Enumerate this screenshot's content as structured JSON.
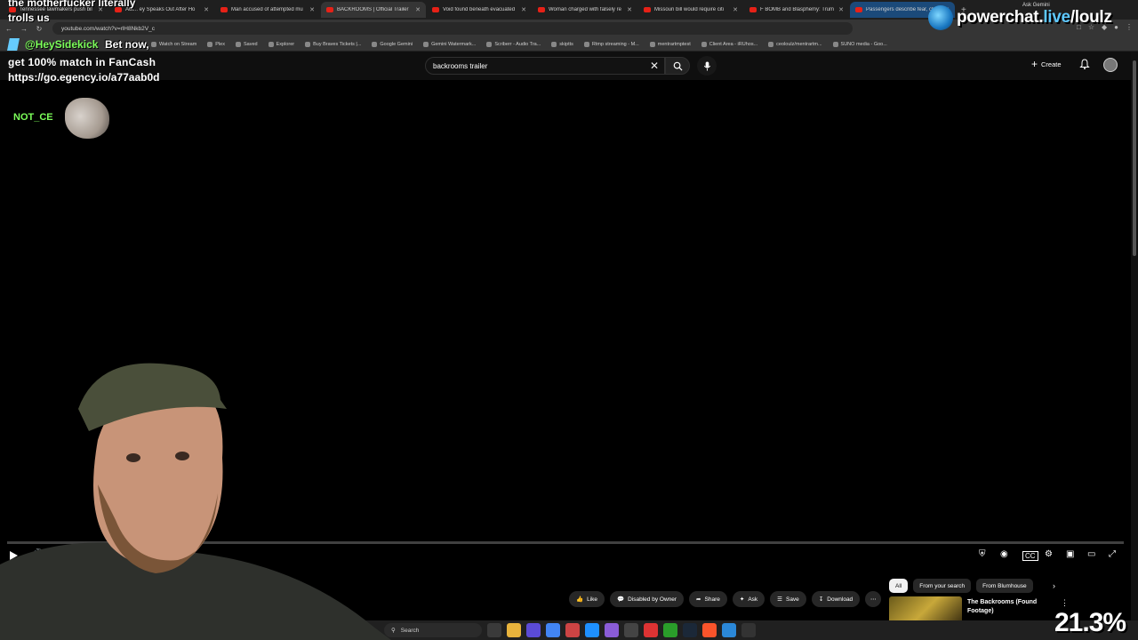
{
  "browser": {
    "tabs": [
      {
        "title": "Tennessee lawmakers push bil",
        "active": false
      },
      {
        "title": "Aut... ey Speaks Out After Ho",
        "active": false
      },
      {
        "title": "Man accused of attempted mu",
        "active": false
      },
      {
        "title": "BACKROOMS | Official Trailer",
        "active": true
      },
      {
        "title": "Void found beneath evacuated",
        "active": false
      },
      {
        "title": "Woman charged with falsely re",
        "active": false
      },
      {
        "title": "Missouri bill would require citi",
        "active": false
      },
      {
        "title": "F BOMB and Blasphemy: Trum",
        "active": false
      },
      {
        "title": "Passengers describe fear, cha",
        "active": false,
        "selected": true
      }
    ],
    "ask_gemini": "Ask Gemini",
    "url": "youtube.com/watch?v=rlH8Nkb2V_c",
    "bookmarks": [
      "Watch on Stream",
      "Plex",
      "Saved",
      "Explorer",
      "Buy Braves Tickets |...",
      "Google Gemini",
      "Gemini Watermark...",
      "Scriberr - Audio Tra...",
      "skiptts",
      "Rtmp streaming - M...",
      "mentrartmptest",
      "Client Area - iRUhos...",
      "ceoloulz/mentrartm...",
      "SUNO media - Goo..."
    ]
  },
  "youtube": {
    "search_value": "backrooms trailer",
    "create_label": "Create",
    "actions": {
      "like": "Like",
      "comments": "Disabled by Owner",
      "share": "Share",
      "ask": "Ask",
      "save": "Save",
      "download": "Download"
    },
    "chips": [
      "All",
      "From your search",
      "From Blumhouse"
    ],
    "recommendation": {
      "title": "The Backrooms (Found Footage)"
    }
  },
  "taskbar": {
    "search_label": "Search"
  },
  "overlay": {
    "top_line1": "the motherfucker literally",
    "top_line2": "trolls us",
    "brand_pre": "powerchat.",
    "brand_live": "live",
    "brand_post": "/loulz",
    "handle": "@HeySidekick",
    "handle_msg": "Bet now,",
    "promo1": "get 100% match in FanCash",
    "promo2": "https://go.egency.io/a77aab0d",
    "user_tag": "NOT_CE",
    "zoom": "21.3%"
  },
  "colors": {
    "youtube_red": "#e62117",
    "handle_green": "#7cff5a",
    "brand_blue": "#5ec8ff"
  }
}
